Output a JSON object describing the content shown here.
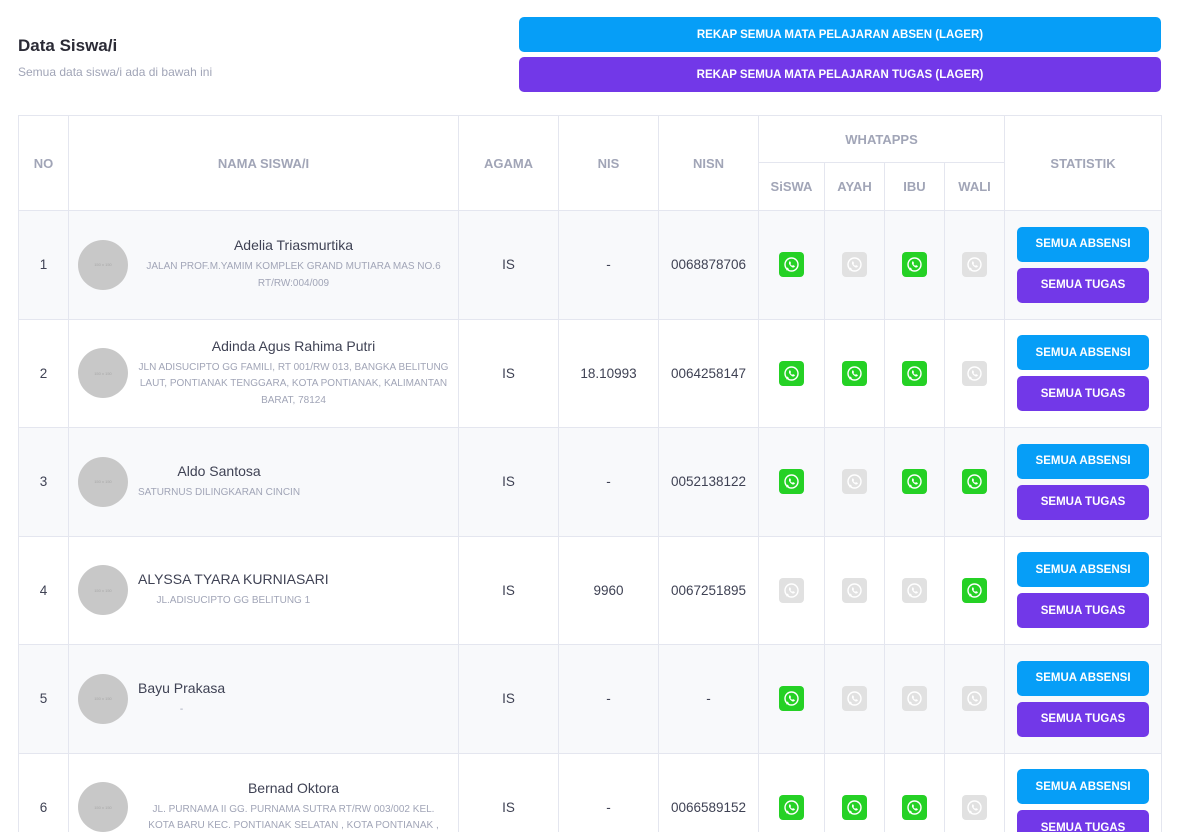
{
  "header": {
    "title": "Data Siswa/i",
    "subtitle": "Semua data siswa/i ada di bawah ini"
  },
  "actions": {
    "rekap_absen": "REKAP SEMUA MATA PELAJARAN ABSEN (LAGER)",
    "rekap_tugas": "REKAP SEMUA MATA PELAJARAN TUGAS (LAGER)"
  },
  "columns": {
    "no": "NO",
    "nama": "NAMA SISWA/I",
    "agama": "AGAMA",
    "nis": "NIS",
    "nisn": "NISN",
    "whatapps": "WHATAPPS",
    "siswa": "SiSWA",
    "ayah": "AYAH",
    "ibu": "IBU",
    "wali": "WALI",
    "statistik": "STATISTIK"
  },
  "avatar_placeholder": "150 x 150",
  "colors": {
    "absen_button": "#069ef7",
    "tugas_button": "#7238e8",
    "whatsapp_active": "#25d125",
    "whatsapp_inactive": "#e1e1e1"
  },
  "row_buttons": {
    "absensi": "SEMUA ABSENSI",
    "tugas": "SEMUA TUGAS"
  },
  "students": [
    {
      "no": "1",
      "name": "Adelia Triasmurtika",
      "address": "JALAN PROF.M.YAMIM KOMPLEK GRAND MUTIARA MAS NO.6 RT/RW:004/009",
      "agama": "IS",
      "nis": "-",
      "nisn": "0068878706",
      "whatsapp": {
        "siswa": true,
        "ayah": false,
        "ibu": true,
        "wali": false
      }
    },
    {
      "no": "2",
      "name": "Adinda Agus Rahima Putri",
      "address": "JLN ADISUCIPTO GG FAMILI, RT 001/RW 013, BANGKA BELITUNG LAUT, PONTIANAK TENGGARA, KOTA PONTIANAK, KALIMANTAN BARAT, 78124",
      "agama": "IS",
      "nis": "18.10993",
      "nisn": "0064258147",
      "whatsapp": {
        "siswa": true,
        "ayah": true,
        "ibu": true,
        "wali": false
      }
    },
    {
      "no": "3",
      "name": "Aldo Santosa",
      "address": "SATURNUS DILINGKARAN CINCIN",
      "agama": "IS",
      "nis": "-",
      "nisn": "0052138122",
      "whatsapp": {
        "siswa": true,
        "ayah": false,
        "ibu": true,
        "wali": true
      }
    },
    {
      "no": "4",
      "name": "ALYSSA TYARA KURNIASARI",
      "address": "JL.ADISUCIPTO GG BELITUNG 1",
      "agama": "IS",
      "nis": "9960",
      "nisn": "0067251895",
      "whatsapp": {
        "siswa": false,
        "ayah": false,
        "ibu": false,
        "wali": true
      }
    },
    {
      "no": "5",
      "name": "Bayu Prakasa",
      "address": "-",
      "agama": "IS",
      "nis": "-",
      "nisn": "-",
      "whatsapp": {
        "siswa": true,
        "ayah": false,
        "ibu": false,
        "wali": false
      }
    },
    {
      "no": "6",
      "name": "Bernad Oktora",
      "address": "JL. PURNAMA II GG. PURNAMA SUTRA RT/RW 003/002 KEL. KOTA BARU KEC. PONTIANAK SELATAN , KOTA PONTIANAK ,",
      "agama": "IS",
      "nis": "-",
      "nisn": "0066589152",
      "whatsapp": {
        "siswa": true,
        "ayah": true,
        "ibu": true,
        "wali": false
      }
    }
  ]
}
